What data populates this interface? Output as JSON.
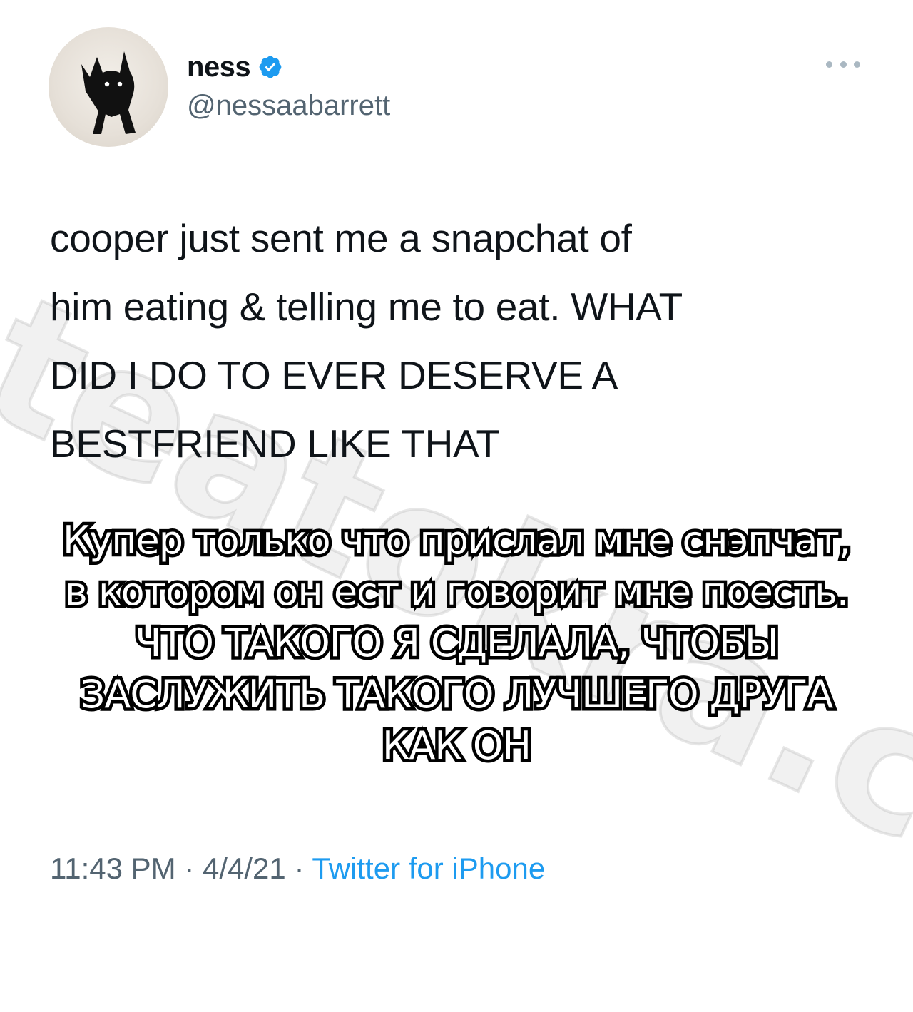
{
  "tweet": {
    "author": {
      "display_name": "ness",
      "handle": "@nessaabarrett",
      "verified": true,
      "avatar_icon": "black-cat-avatar"
    },
    "more_icon": "more-horizontal-icon",
    "text_lines": [
      "cooper just sent me a snapchat of",
      "him eating & telling me to eat. WHAT",
      "DID I DO TO EVER DESERVE A",
      "BESTFRIEND LIKE THAT"
    ],
    "time": "11:43 PM",
    "date": "4/4/21",
    "separator": "·",
    "source": "Twitter for iPhone"
  },
  "overlay_translation": [
    "Купер только что прислал мне снэпчат,",
    "в котором он ест и говорит мне поесть.",
    "ЧТО ТАКОГО Я СДЕЛАЛА, ЧТОБЫ",
    "ЗАСЛУЖИТЬ ТАКОГО ЛУЧШЕГО ДРУГА",
    "КАК ОН"
  ],
  "watermark": "teatokra.com",
  "colors": {
    "text": "#0f1419",
    "secondary": "#536471",
    "link": "#1d9bf0",
    "verified": "#1d9bf0",
    "caption_fill": "#ffffff",
    "caption_stroke": "#000000"
  }
}
